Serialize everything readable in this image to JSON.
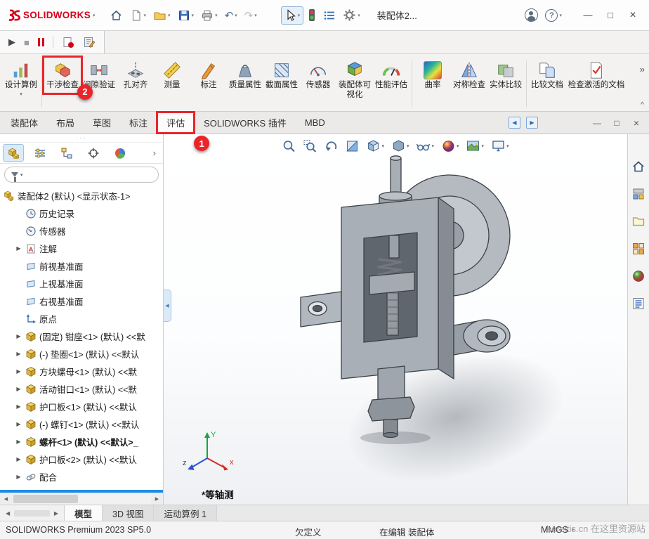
{
  "titlebar": {
    "logo_text": "SOLIDWORKS",
    "document_title": "装配体2..."
  },
  "ribbon": {
    "buttons": [
      {
        "id": "design-study",
        "label": "设计算例"
      },
      {
        "id": "interference-detection",
        "label": "干涉检查"
      },
      {
        "id": "clearance-verification",
        "label": "间隙验证"
      },
      {
        "id": "hole-alignment",
        "label": "孔对齐"
      },
      {
        "id": "measure",
        "label": "测量"
      },
      {
        "id": "markup",
        "label": "标注"
      },
      {
        "id": "mass-properties",
        "label": "质量属性"
      },
      {
        "id": "section-properties",
        "label": "截面属性"
      },
      {
        "id": "sensor",
        "label": "传感器"
      },
      {
        "id": "assembly-visualization",
        "label": "装配体可视化"
      },
      {
        "id": "performance-evaluation",
        "label": "性能评估"
      },
      {
        "id": "curvature",
        "label": "曲率"
      },
      {
        "id": "symmetry-check",
        "label": "对称检查"
      },
      {
        "id": "compare-entities",
        "label": "实体比较"
      },
      {
        "id": "compare-documents",
        "label": "比较文档"
      },
      {
        "id": "check-active-document",
        "label": "检查激活的文档"
      }
    ]
  },
  "command_tabs": [
    {
      "label": "装配体"
    },
    {
      "label": "布局"
    },
    {
      "label": "草图"
    },
    {
      "label": "标注"
    },
    {
      "label": "评估"
    },
    {
      "label": "SOLIDWORKS 插件"
    },
    {
      "label": "MBD"
    }
  ],
  "feature_tree": {
    "root_label": "装配体2 (默认) <显示状态-1>",
    "items": [
      {
        "label": "历史记录"
      },
      {
        "label": "传感器"
      },
      {
        "label": "注解"
      },
      {
        "label": "前视基准面"
      },
      {
        "label": "上视基准面"
      },
      {
        "label": "右视基准面"
      },
      {
        "label": "原点"
      },
      {
        "label": "(固定) 钳座<1> (默认) <<默"
      },
      {
        "label": "(-) 垫圈<1> (默认) <<默认"
      },
      {
        "label": "方块螺母<1> (默认) <<默"
      },
      {
        "label": "活动钳口<1> (默认) <<默"
      },
      {
        "label": "护口板<1> (默认) <<默认"
      },
      {
        "label": "(-) 螺钉<1> (默认) <<默认"
      },
      {
        "label": "螺杆<1> (默认) <<默认>_"
      },
      {
        "label": "护口板<2> (默认) <<默认"
      },
      {
        "label": "配合"
      }
    ]
  },
  "viewport": {
    "view_label": "*等轴测",
    "triad": {
      "x": "x",
      "y": "Y",
      "z": "z"
    }
  },
  "bottom_tabs": [
    {
      "label": "模型"
    },
    {
      "label": "3D 视图"
    },
    {
      "label": "运动算例 1"
    }
  ],
  "statusbar": {
    "product": "SOLIDWORKS Premium 2023 SP5.0",
    "definition": "欠定义",
    "editing": "在编辑 装配体",
    "units": "MMGS",
    "watermark": "hereitis.cn 在这里资源站"
  },
  "annotations": {
    "step1": "1",
    "step2": "2"
  },
  "glyphs": {
    "caret": "▾",
    "overflow": "»",
    "collapse": "^",
    "left": "◀",
    "right": "▶",
    "play": "▶",
    "stop": "■",
    "minimize": "—",
    "maximize": "□",
    "close": "×",
    "help": "?",
    "expand": "▶",
    "panel_expand": "›",
    "dots": "···",
    "undo": "↶",
    "redo": "↷"
  },
  "colors": {
    "annotation_red": "#e8262a",
    "brand_red": "#d6001c",
    "selection_blue": "#1b8ce8"
  }
}
